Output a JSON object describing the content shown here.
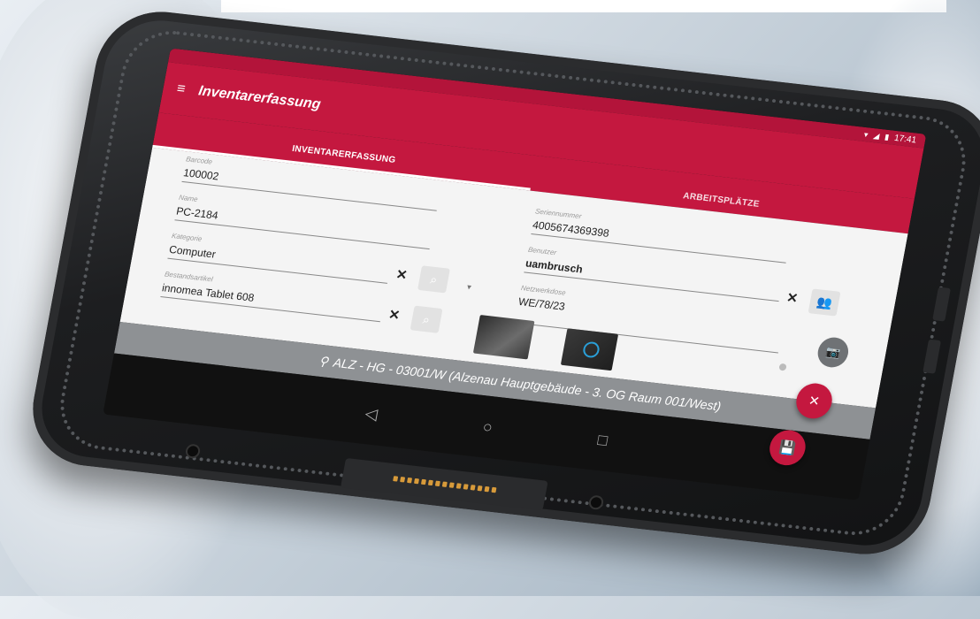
{
  "statusbar": {
    "time": "17:41",
    "wifi_icon": "wifi-icon",
    "signal_icon": "signal-icon",
    "battery_icon": "battery-icon"
  },
  "app": {
    "title": "Inventarerfassung",
    "menu_icon": "hamburger-menu-icon"
  },
  "tabs": [
    {
      "label": "INVENTARERFASSUNG",
      "active": true
    },
    {
      "label": "ARBEITSPLÄTZE",
      "active": false
    }
  ],
  "left_fields": {
    "barcode": {
      "label": "Barcode",
      "value": "100002"
    },
    "name": {
      "label": "Name",
      "value": "PC-2184"
    },
    "kategorie": {
      "label": "Kategorie",
      "value": "Computer"
    },
    "bestandsartikel": {
      "label": "Bestandsartikel",
      "value": "innomea Tablet 608"
    }
  },
  "right_fields": {
    "seriennummer": {
      "label": "Seriennummer",
      "value": "4005674369398"
    },
    "benutzer": {
      "label": "Benutzer",
      "value": "uambrusch"
    },
    "netzwerkdose": {
      "label": "Netzwerkdose",
      "value": "WE/78/23"
    }
  },
  "clear_symbol": "✕",
  "location": "ALZ - HG - 03001/W (Alzenau Hauptgebäude - 3. OG Raum 001/West)",
  "nav": {
    "back": "◁",
    "home": "○",
    "recents": "□"
  },
  "fabs": {
    "cancel": "✕",
    "save": "💾",
    "camera": "📷"
  },
  "colors": {
    "primary": "#c4183f",
    "location_bar": "#8e9194"
  }
}
